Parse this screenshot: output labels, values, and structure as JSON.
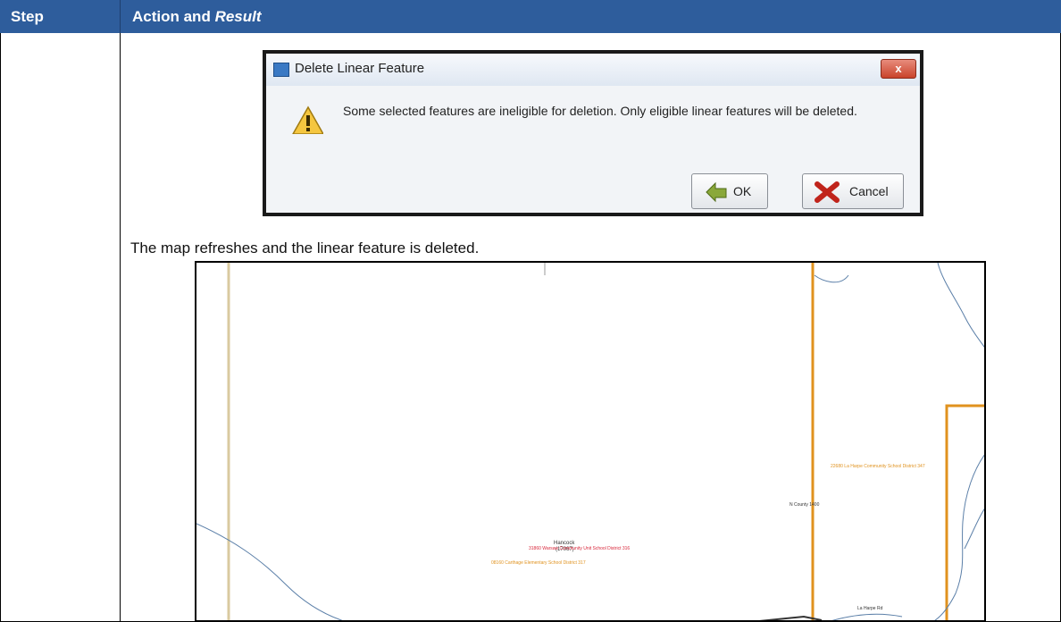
{
  "table": {
    "header": {
      "step_label": "Step",
      "action_label": "Action and ",
      "result_label": "Result"
    }
  },
  "dialog": {
    "title": "Delete Linear Feature",
    "close_symbol": "x",
    "message": "Some selected features are ineligible for deletion. Only eligible linear features will be deleted.",
    "ok_label": "OK",
    "cancel_label": "Cancel"
  },
  "caption": "The map refreshes and the linear feature is deleted.",
  "map": {
    "labels": {
      "place_name": "Hancock",
      "place_code": "(17067)",
      "district_red": "31860 Warsaw Community Unit School District 316",
      "district_orange_1": "08160 Carthage Elementary School District 317",
      "district_orange_2": "22680 La Harpe Community School District 347",
      "road_1": "N County 1400",
      "road_2": "La Harpe Rd"
    }
  },
  "colors": {
    "header_bg": "#2e5d9c",
    "orange_boundary": "#e0921e",
    "water": "#5b7fa8",
    "road_tan": "#d9caa0"
  }
}
